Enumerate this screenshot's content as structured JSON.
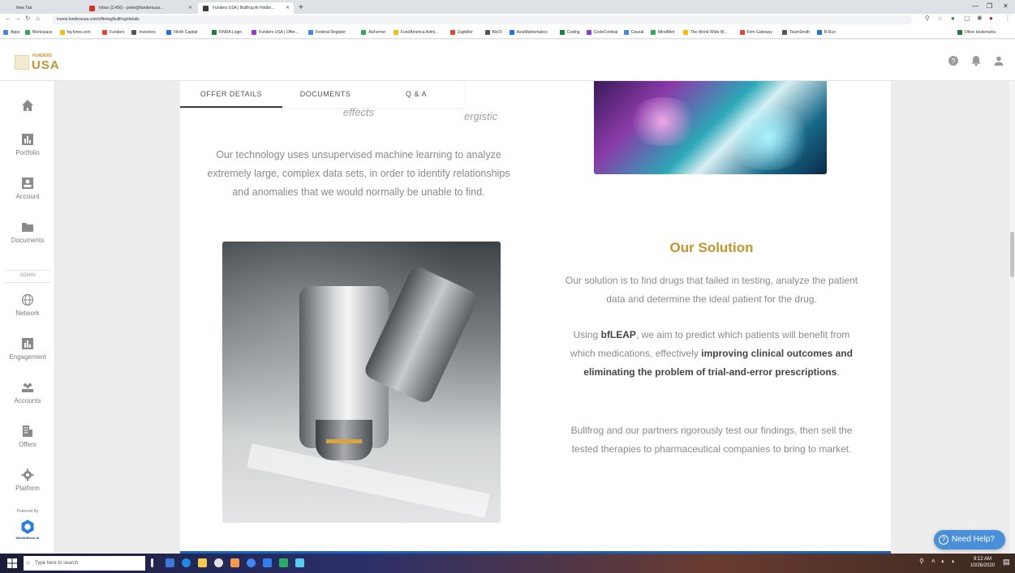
{
  "browser": {
    "tabs": [
      {
        "title": "New Tab"
      },
      {
        "title": "Inbox (3,456) - peter@fundersusa..."
      },
      {
        "title": "Funders USA | Bullfrog AI Holdin..."
      }
    ],
    "url": "invest.fundersusa.com/offering/bullfrog/details",
    "bookmarks": [
      "Apps",
      "Workspace",
      "hq.fores.com",
      "Funders",
      "Investors",
      "North Capital",
      "FINRA Login",
      "Funders USA | Offer...",
      "Federal Register",
      "Alchemer",
      "FundAmerica Admi...",
      "Zapbiller",
      "BizOI",
      "AsiaMathematics",
      "Coding",
      "CodeCombat",
      "Causal",
      "MindMint",
      "The World Wide W...",
      "Firm Gateway",
      "TeamSmith",
      "B-Run",
      "Other bookmarks"
    ]
  },
  "app": {
    "logo_top": "FUNDERS",
    "logo_main": "USA",
    "header_icons": [
      "help-icon",
      "bell-icon",
      "user-icon"
    ]
  },
  "sidebar": {
    "items": [
      {
        "label": "",
        "icon": "home-icon"
      },
      {
        "label": "Portfolio",
        "icon": "portfolio-icon"
      },
      {
        "label": "Account",
        "icon": "account-icon"
      },
      {
        "label": "Documents",
        "icon": "folder-icon"
      }
    ],
    "admin_label": "ADMIN",
    "admin_items": [
      {
        "label": "Network",
        "icon": "globe-icon"
      },
      {
        "label": "Engagement",
        "icon": "chart-icon"
      },
      {
        "label": "Accounts",
        "icon": "people-icon"
      },
      {
        "label": "Offers",
        "icon": "building-icon"
      },
      {
        "label": "Platform",
        "icon": "gear-icon"
      }
    ],
    "powered_by": "Powered By",
    "powered_brand": "WealthBlock.AI"
  },
  "offer": {
    "tabs": [
      "OFFER DETAILS",
      "DOCUMENTS",
      "Q & A"
    ],
    "clipped_text_1": "ergistic",
    "clipped_text_2": "effects",
    "tech_paragraph": "Our technology uses unsupervised machine learning to analyze extremely large, complex data sets, in order to identify relationships and anomalies that we would normally be unable to find.",
    "solution_title": "Our Solution",
    "solution_p1": "Our solution is to find drugs that failed in testing, analyze the patient data and determine the ideal patient for the drug.",
    "solution_p2_pre": "Using ",
    "solution_p2_brand": "bfLEAP",
    "solution_p2_mid": ", we aim to predict which patients will benefit from which medications, effectively ",
    "solution_p2_bold": "improving clinical outcomes and eliminating the problem of trial-and-error prescriptions",
    "solution_p2_end": ".",
    "solution_p3": "Bullfrog and our partners rigorously test our findings, then sell the tested therapies to pharmaceutical companies to bring to market."
  },
  "help_button": "Need Help?",
  "taskbar": {
    "search_placeholder": "Type here to search",
    "time": "9:12 AM",
    "date": "10/26/2020"
  },
  "colors": {
    "accent_gold": "#c8932a",
    "help_blue": "#4a90d9",
    "footer_blue": "#1565c0"
  }
}
